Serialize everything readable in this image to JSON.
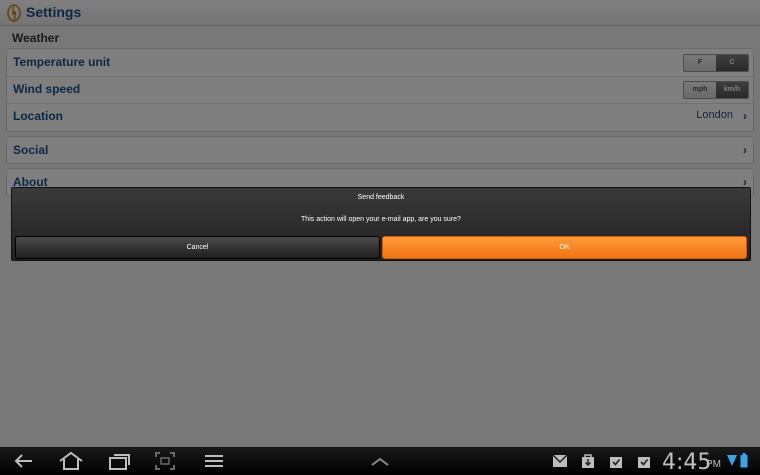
{
  "app": {
    "title": "Settings"
  },
  "weather": {
    "section_label": "Weather",
    "temperature": {
      "label": "Temperature unit",
      "options": [
        "F",
        "C"
      ],
      "selected": "C"
    },
    "wind": {
      "label": "Wind speed",
      "options": [
        "mph",
        "km/h"
      ],
      "selected": "km/h"
    },
    "location": {
      "label": "Location",
      "value": "London"
    }
  },
  "social": {
    "label": "Social"
  },
  "about": {
    "label": "About"
  },
  "dialog": {
    "title": "Send feedback",
    "message": "This action will open your e-mail app, are you sure?",
    "cancel_label": "Cancel",
    "ok_label": "OK"
  },
  "status": {
    "time": "4:45",
    "ampm": "PM"
  },
  "colors": {
    "accent": "#1a4f8a",
    "ok_button": "#f7821a"
  }
}
